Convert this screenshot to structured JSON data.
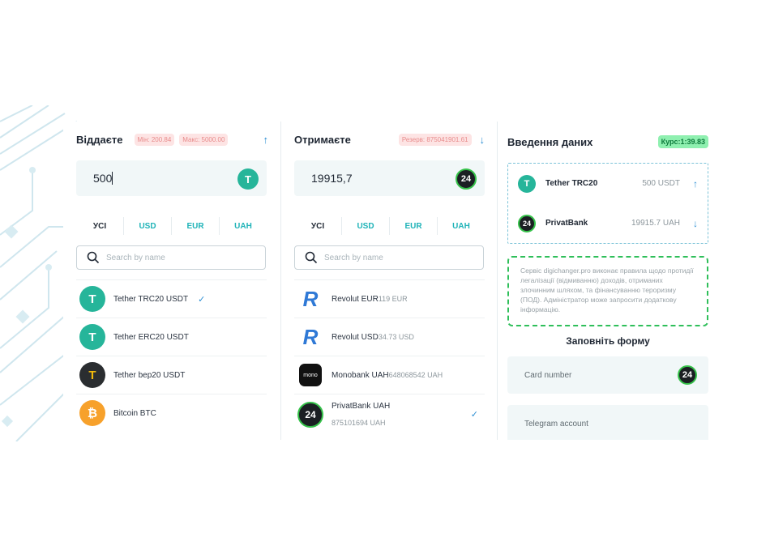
{
  "give": {
    "title": "Віддаєте",
    "min": "Мін: 200.84",
    "max": "Макс: 5000.00",
    "amount": "500",
    "tabs": [
      "УСІ",
      "USD",
      "EUR",
      "UAH"
    ],
    "search_placeholder": "Search by name",
    "items": [
      {
        "name": "Tether TRC20 USDT",
        "icon": "tether-trc20-icon",
        "selected": true
      },
      {
        "name": "Tether ERC20 USDT",
        "icon": "tether-erc20-icon",
        "selected": false
      },
      {
        "name": "Tether bep20 USDT",
        "icon": "tether-bep20-icon",
        "selected": false
      },
      {
        "name": "Bitcoin BTC",
        "icon": "bitcoin-icon",
        "selected": false
      }
    ]
  },
  "receive": {
    "title": "Отримаєте",
    "reserve": "Резерв: 875041901.61",
    "amount": "19915,7",
    "badge": "24",
    "tabs": [
      "УСІ",
      "USD",
      "EUR",
      "UAH"
    ],
    "search_placeholder": "Search by name",
    "items": [
      {
        "name": "Revolut EUR",
        "reserve": "119 EUR",
        "icon": "revolut-icon"
      },
      {
        "name": "Revolut USD",
        "reserve": "34.73 USD",
        "icon": "revolut-icon"
      },
      {
        "name": "Monobank UAH",
        "reserve": "648068542 UAH",
        "icon": "monobank-icon",
        "icon_text": "mono"
      },
      {
        "name": "PrivatBank UAH",
        "reserve": "875101694 UAH",
        "icon": "privatbank-icon",
        "icon_text": "24",
        "selected": true
      }
    ]
  },
  "data_entry": {
    "title": "Введення даних",
    "rate": "Курс:1:39.83",
    "summary": [
      {
        "name": "Tether TRC20",
        "amount": "500 USDT",
        "icon": "tether-trc20-icon",
        "arrow": "↑"
      },
      {
        "name": "PrivatBank",
        "amount": "19915.7 UAH",
        "icon": "privatbank-icon",
        "icon_text": "24",
        "arrow": "↓"
      }
    ],
    "notice": "Сервіс digichanger.pro виконає правила щодо протидії легалізації (відмиванню) доходів, отриманих злочинним шляхом, та фінансуванню тероризму (ПОД). Адміністратор може запросити додаткову інформацію.",
    "form_title": "Заповніть форму",
    "card_label": "Card number",
    "card_badge": "24",
    "telegram_label": "Telegram account"
  },
  "colors": {
    "accent": "#1fb3b8",
    "tether": "#26b59a",
    "privat_ring": "#36c24a",
    "rate_bg": "#8ff0b0",
    "limit_bg": "#fde4e4"
  }
}
